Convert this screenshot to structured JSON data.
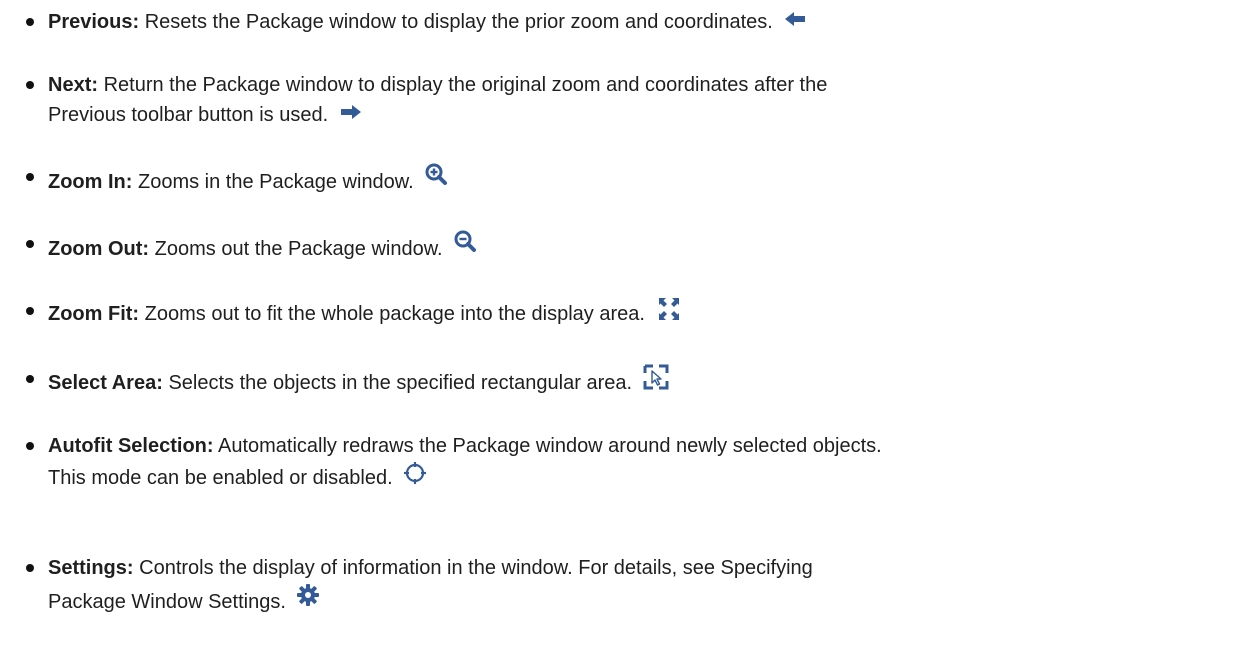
{
  "items": [
    {
      "term": "Previous:",
      "description": "Resets the Package window to display the prior zoom and coordinates.",
      "icon": "arrow-left-icon"
    },
    {
      "term": "Next:",
      "description": "Return the Package window to display the original zoom and coordinates after the",
      "description_line2": "Previous toolbar button is used.",
      "icon": "arrow-right-icon"
    },
    {
      "term": "Zoom In:",
      "description": "Zooms in the Package window.",
      "icon": "zoom-in-icon"
    },
    {
      "term": "Zoom Out:",
      "description": "Zooms out the Package window.",
      "icon": "zoom-out-icon"
    },
    {
      "term": "Zoom Fit:",
      "description": "Zooms out to fit the whole package into the display area.",
      "icon": "zoom-fit-icon"
    },
    {
      "term": "Select Area:",
      "description": "Selects the objects in the specified rectangular area.",
      "icon": "select-area-icon"
    },
    {
      "term": "Autofit Selection:",
      "description": "Automatically redraws the Package window around newly selected objects.",
      "description_line2": "This mode can be enabled or disabled.",
      "icon": "autofit-selection-icon"
    },
    {
      "term": "Settings:",
      "description": "Controls the display of information in the window. For details, see Specifying",
      "description_line2": "Package Window Settings.",
      "icon": "settings-gear-icon"
    }
  ],
  "colors": {
    "icon_blue": "#335b97",
    "text": "#1f1f1f"
  }
}
